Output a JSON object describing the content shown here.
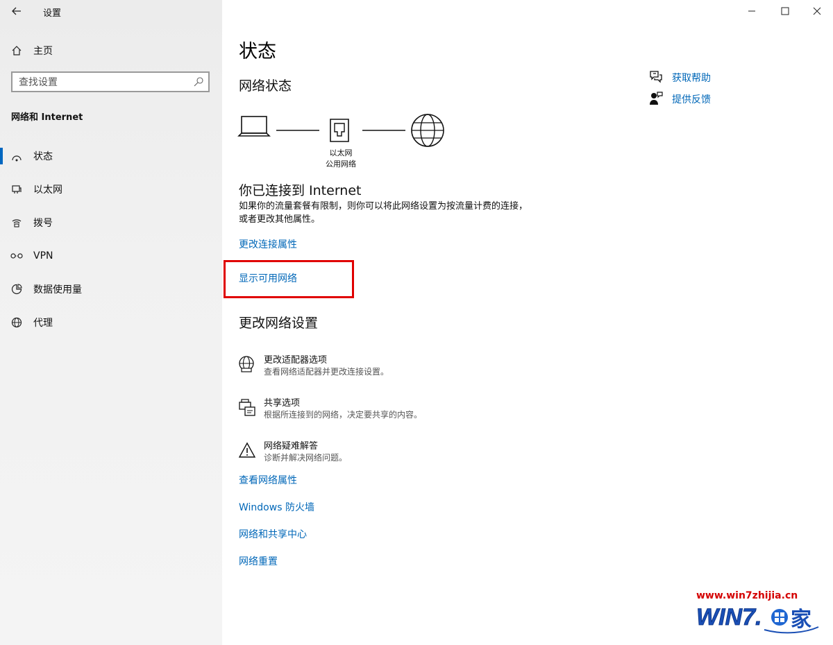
{
  "window": {
    "title": "设置",
    "back_icon": "back-arrow-icon"
  },
  "sidebar": {
    "home_label": "主页",
    "search_placeholder": "查找设置",
    "section_title": "网络和 Internet",
    "items": [
      {
        "label": "状态",
        "icon": "status-icon",
        "active": true
      },
      {
        "label": "以太网",
        "icon": "ethernet-icon"
      },
      {
        "label": "拨号",
        "icon": "dialup-icon"
      },
      {
        "label": "VPN",
        "icon": "vpn-icon"
      },
      {
        "label": "数据使用量",
        "icon": "data-usage-icon"
      },
      {
        "label": "代理",
        "icon": "proxy-globe-icon"
      }
    ]
  },
  "main": {
    "page_title": "状态",
    "network_status_heading": "网络状态",
    "diagram": {
      "device_label_1": "以太网",
      "device_label_2": "公用网络"
    },
    "connected_heading": "你已连接到 Internet",
    "connected_desc": "如果你的流量套餐有限制，则你可以将此网络设置为按流量计费的连接，或者更改其他属性。",
    "change_props_link": "更改连接属性",
    "show_networks_link": "显示可用网络",
    "change_settings_heading": "更改网络设置",
    "options": [
      {
        "title": "更改适配器选项",
        "subtitle": "查看网络适配器并更改连接设置。",
        "icon": "adapter-globe-icon"
      },
      {
        "title": "共享选项",
        "subtitle": "根据所连接到的网络，决定要共享的内容。",
        "icon": "sharing-printer-icon"
      },
      {
        "title": "网络疑难解答",
        "subtitle": "诊断并解决网络问题。",
        "icon": "warning-triangle-icon"
      }
    ],
    "links": [
      "查看网络属性",
      "Windows 防火墙",
      "网络和共享中心",
      "网络重置"
    ]
  },
  "help": {
    "get_help": "获取帮助",
    "feedback": "提供反馈"
  },
  "watermark": {
    "url": "www.win7zhijia.cn",
    "logo_text": "WIN7",
    "logo_suffix": "家"
  },
  "colors": {
    "link": "#0067b8",
    "accent": "#0067c0",
    "highlight_box": "#e00000"
  }
}
